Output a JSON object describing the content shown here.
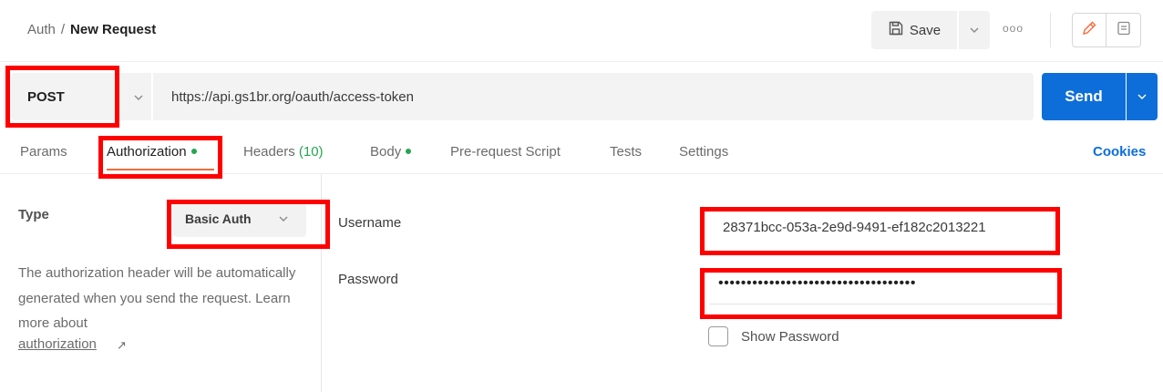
{
  "breadcrumb": {
    "parent": "Auth",
    "separator": "/",
    "current": "New Request"
  },
  "toolbar": {
    "save_label": "Save",
    "more_label": "ooo"
  },
  "request": {
    "method": "POST",
    "url": "https://api.gs1br.org/oauth/access-token",
    "send_label": "Send"
  },
  "tabs": {
    "params": "Params",
    "authorization": "Authorization",
    "headers": "Headers",
    "headers_count": "(10)",
    "body": "Body",
    "prerequest": "Pre-request Script",
    "tests": "Tests",
    "settings": "Settings",
    "cookies": "Cookies"
  },
  "auth": {
    "type_label": "Type",
    "type_value": "Basic Auth",
    "help_text": "The authorization header will be automatically generated when you send the request. Learn more about",
    "help_link": "authorization",
    "help_link_arrow": "↗",
    "username_label": "Username",
    "username_value": "28371bcc-053a-2e9d-9491-ef182c2013221",
    "password_label": "Password",
    "password_value": "•••••••••••••••••••••••••••••••••••",
    "show_password_label": "Show Password",
    "show_password_checked": false
  },
  "colors": {
    "accent_blue": "#0d6ed9",
    "status_green": "#26a552",
    "active_tab_underline": "#f26b3a",
    "annotation_red": "#ff0000"
  },
  "icons": [
    "save-icon",
    "chevron-down-icon",
    "more-options-icon",
    "pencil-icon",
    "comment-icon",
    "external-link-icon",
    "checkbox-icon"
  ]
}
